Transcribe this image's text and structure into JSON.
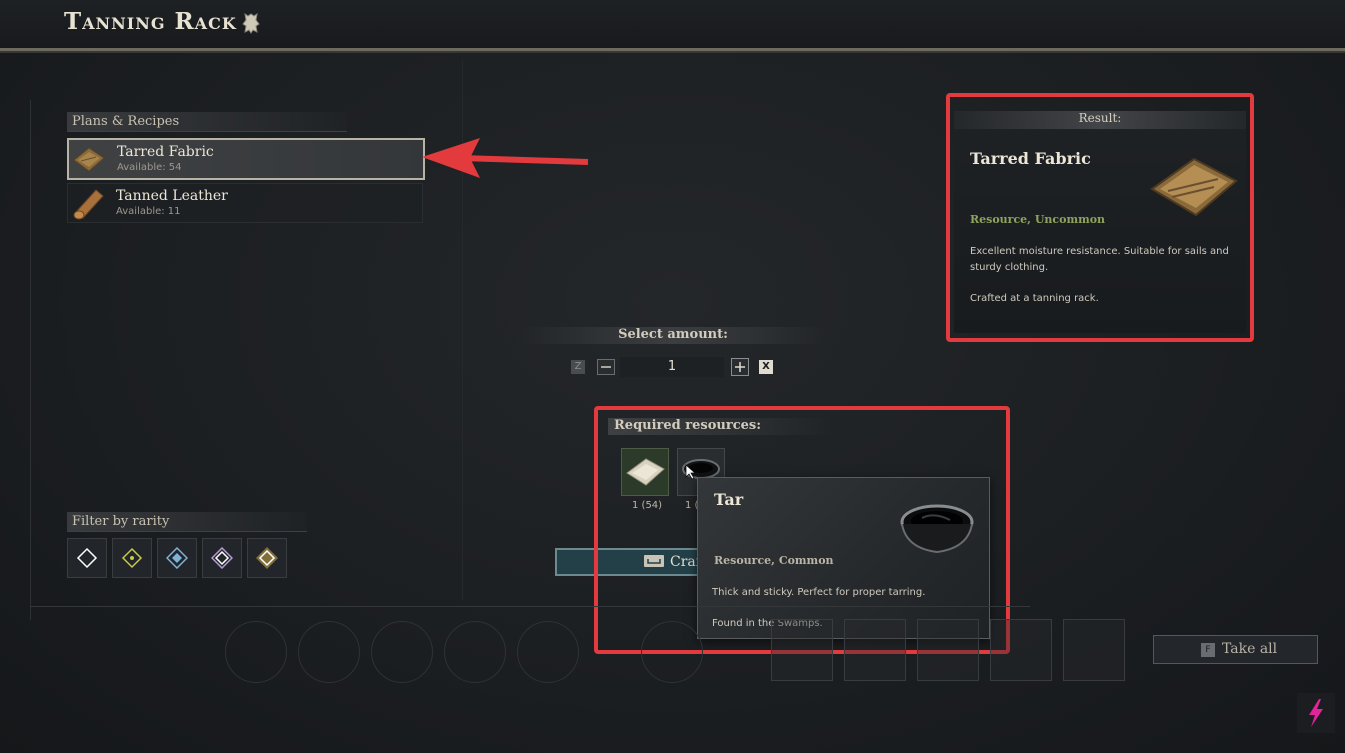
{
  "window": {
    "title": "Tanning Rack",
    "title_icon": "leather-hide-icon"
  },
  "recipes": {
    "header": "Plans & Recipes",
    "items": [
      {
        "name": "Tarred Fabric",
        "available": "Available: 54",
        "icon": "fabric-icon",
        "selected": true
      },
      {
        "name": "Tanned Leather",
        "available": "Available: 11",
        "icon": "leather-roll-icon",
        "selected": false
      }
    ]
  },
  "filter": {
    "header": "Filter by rarity",
    "rarities": [
      "common",
      "uncommon",
      "rare",
      "epic",
      "legendary"
    ],
    "colors": [
      "#ffffff",
      "#c9c94a",
      "#7fb3d6",
      "#b99ad8",
      "#e2b64a"
    ]
  },
  "result": {
    "header": "Result:",
    "name": "Tarred Fabric",
    "category": "Resource, Uncommon",
    "description": "Excellent moisture resistance. Suitable for sails and sturdy clothing.",
    "note": "Crafted at a tanning rack."
  },
  "amount": {
    "header": "Select amount:",
    "value": "1",
    "min_key": "Z",
    "max_key": "X"
  },
  "required": {
    "header": "Required resources:",
    "items": [
      {
        "icon": "cloth-icon",
        "count": "1 (54)"
      },
      {
        "icon": "tar-icon",
        "count": "1 ("
      }
    ]
  },
  "craft": {
    "label": "Craf"
  },
  "tooltip": {
    "name": "Tar",
    "category": "Resource, Common",
    "description": "Thick and sticky. Perfect for proper tarring.",
    "note": "Found in the Swamps."
  },
  "take_all": {
    "key": "F",
    "label": "Take all"
  },
  "colors": {
    "highlight_red": "#e33a3e",
    "uncommon_green": "#8ea45c",
    "craft_teal": "#234049"
  }
}
